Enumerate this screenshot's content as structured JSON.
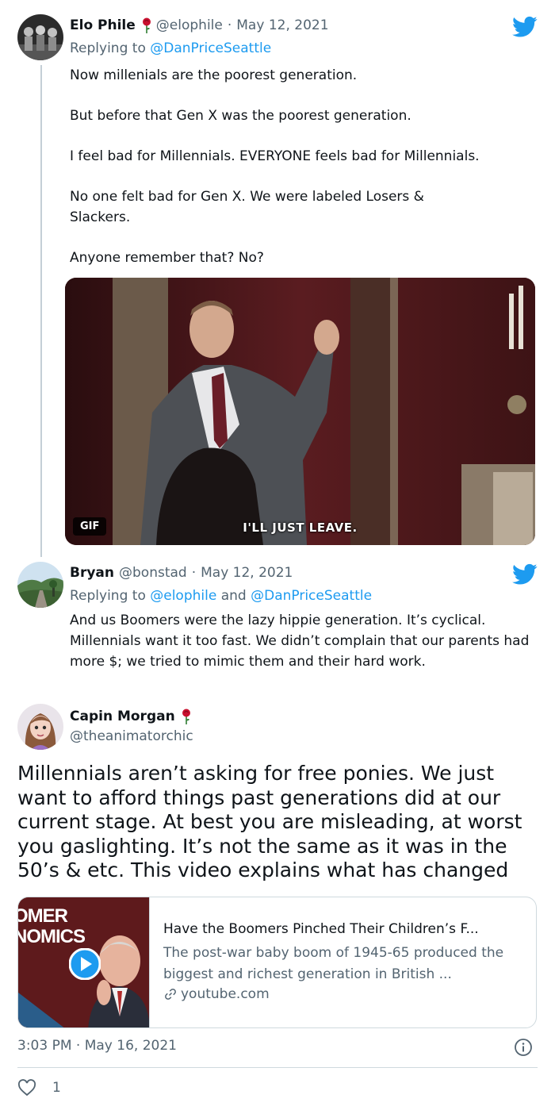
{
  "tweet1": {
    "name": "Elo Phile",
    "handle": "@elophile",
    "date": "May 12, 2021",
    "replying_prefix": "Replying to",
    "replying_to": "@DanPriceSeattle",
    "paragraphs": [
      "Now millenials are the poorest generation.",
      "But before that Gen X was the poorest generation.",
      "I feel bad for Millennials. EVERYONE feels bad for Millennials.",
      "No one felt bad for Gen X. We were labeled Losers & Slackers.",
      "Anyone remember that? No?"
    ],
    "gif_badge": "GIF",
    "gif_caption": "I'LL JUST LEAVE."
  },
  "tweet2": {
    "name": "Bryan",
    "handle": "@bonstad",
    "date": "May 12, 2021",
    "replying_prefix": "Replying to",
    "replying_to_1": "@elophile",
    "replying_and": "and",
    "replying_to_2": "@DanPriceSeattle",
    "text": "And us Boomers were the lazy hippie generation. It’s cyclical. Millennials want it too fast. We didn’t complain that our parents had more $; we tried to mimic them and their hard work."
  },
  "tweet3": {
    "name": "Capin Morgan",
    "handle": "@theanimatorchic",
    "text": "Millennials aren’t asking for free ponies. We just want to afford things past generations did at our current stage. At best you are misleading, at worst you gaslighting.  It’s not the same as it was in the 50’s & etc.  This video explains what has changed",
    "card": {
      "thumb_text_line1": "OMER",
      "thumb_text_line2": "NOMICS",
      "title": "Have the Boomers Pinched Their Children’s F...",
      "description": "The post-war baby boom of 1945-65 produced the biggest and richest generation in British ...",
      "domain": "youtube.com"
    },
    "timestamp": "3:03 PM · May 16, 2021",
    "likes": "1"
  },
  "colors": {
    "accent": "#1d9bf0",
    "secondary_text": "#536471",
    "rose": "#c8102e"
  },
  "separator": "·"
}
